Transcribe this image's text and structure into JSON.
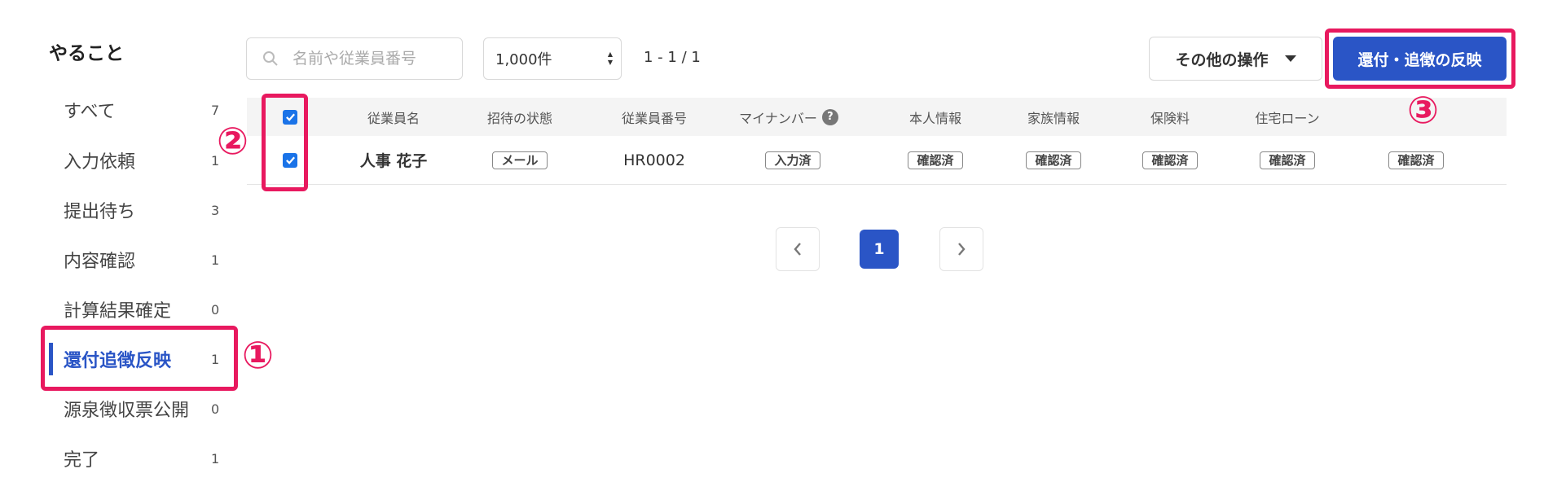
{
  "sidebar": {
    "title": "やること",
    "items": [
      {
        "label": "すべて",
        "count": "7"
      },
      {
        "label": "入力依頼",
        "count": "1"
      },
      {
        "label": "提出待ち",
        "count": "3"
      },
      {
        "label": "内容確認",
        "count": "1"
      },
      {
        "label": "計算結果確定",
        "count": "0"
      },
      {
        "label": "還付追徴反映",
        "count": "1"
      },
      {
        "label": "源泉徴収票公開",
        "count": "0"
      },
      {
        "label": "完了",
        "count": "1"
      }
    ],
    "active_index": 5
  },
  "toolbar": {
    "search_placeholder": "名前や従業員番号",
    "per_page_value": "1,000件",
    "range_text": "1 - 1 / 1",
    "other_ops_label": "その他の操作",
    "apply_label": "還付・追徴の反映"
  },
  "table": {
    "headers": {
      "name": "従業員名",
      "invite": "招待の状態",
      "number": "従業員番号",
      "mynumber": "マイナンバー",
      "personal": "本人情報",
      "family": "家族情報",
      "insurance": "保険料",
      "loan": "住宅ローン",
      "last": ""
    },
    "rows": [
      {
        "name": "人事 花子",
        "invite": "メール",
        "number": "HR0002",
        "mynumber": "入力済",
        "personal": "確認済",
        "family": "確認済",
        "insurance": "確認済",
        "loan": "確認済",
        "last": "確認済"
      }
    ]
  },
  "pagination": {
    "current": "1"
  },
  "annotations": {
    "one": "①",
    "two": "②",
    "three": "③"
  },
  "colors": {
    "accent": "#2a55c6",
    "highlight": "#e8195f",
    "checkbox": "#1a73e8"
  }
}
